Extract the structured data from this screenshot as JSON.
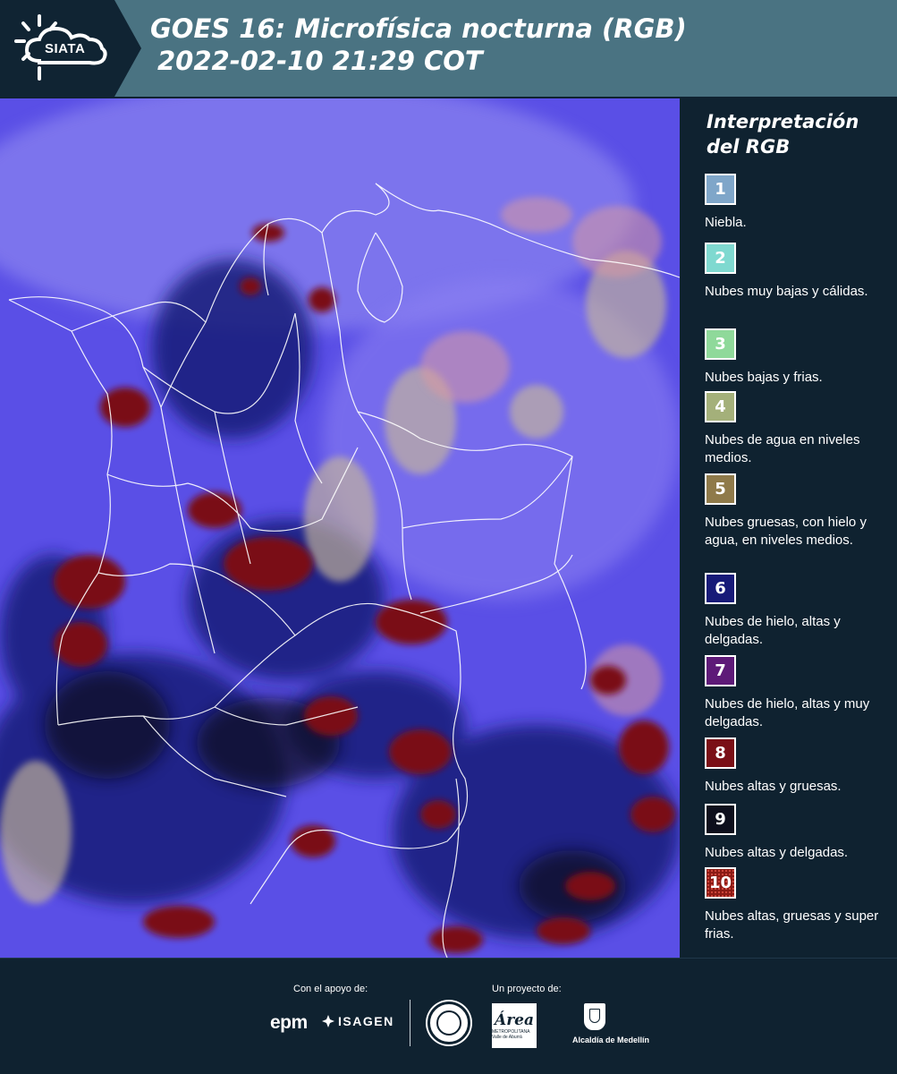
{
  "header": {
    "logo_text": "SIATA",
    "title_line1": "GOES 16: Microfísica nocturna (RGB)",
    "title_line2": "2022-02-10 21:29 COT"
  },
  "legend": {
    "title_line1": "Interpretación",
    "title_line2": "del RGB",
    "items": [
      {
        "number": "1",
        "label": "Niebla.",
        "color": "#7fa6c9"
      },
      {
        "number": "2",
        "label": "Nubes muy bajas y cálidas.",
        "color": "#7fd9d0"
      },
      {
        "number": "3",
        "label": "Nubes bajas y frias.",
        "color": "#8fd99a"
      },
      {
        "number": "4",
        "label": "Nubes de agua en niveles medios.",
        "color": "#a4b07a"
      },
      {
        "number": "5",
        "label": "Nubes gruesas, con hielo y agua, en niveles medios.",
        "color": "#8f7a4a"
      },
      {
        "number": "6",
        "label": "Nubes de hielo, altas y delgadas.",
        "color": "#171a78"
      },
      {
        "number": "7",
        "label": "Nubes de hielo, altas y muy delgadas.",
        "color": "#5e1a78"
      },
      {
        "number": "8",
        "label": "Nubes altas y gruesas.",
        "color": "#7a0f16"
      },
      {
        "number": "9",
        "label": "Nubes altas y delgadas.",
        "color": "#0d0f1c"
      },
      {
        "number": "10",
        "label": "Nubes altas, gruesas y super frias.",
        "color": "#8a1a14"
      }
    ]
  },
  "footer": {
    "support_label": "Con el apoyo de:",
    "project_label": "Un proyecto de:",
    "sponsor1": "epm",
    "sponsor2": "ISAGEN",
    "area_logo": "Área",
    "area_sub": "METROPOLITANA Valle de Aburrá",
    "alcaldia": "Alcaldía de Medellín"
  },
  "map": {
    "background_color": "#5a4fe6",
    "cloud_colors": [
      "#7a0f16",
      "#171a78",
      "#0d0f1c",
      "#a4b07a",
      "#d99aa0",
      "#8f7a4a"
    ]
  }
}
